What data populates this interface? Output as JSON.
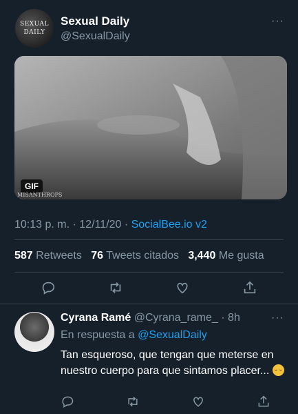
{
  "tweet": {
    "avatar_text": [
      "SEXUAL",
      "DAILY"
    ],
    "name": "Sexual Daily",
    "handle": "@SexualDaily",
    "more_label": "···",
    "media_badge": "GIF",
    "media_watermark": "MISANTHROPS",
    "time": "10:13 p. m.",
    "date": "12/11/20",
    "separator": "·",
    "source": "SocialBee.io v2",
    "retweets_count": "587",
    "retweets_label": "Retweets",
    "quotes_count": "76",
    "quotes_label": "Tweets citados",
    "likes_count": "3,440",
    "likes_label": "Me gusta"
  },
  "reply": {
    "name": "Cyrana Ramé",
    "handle": "@Cyrana_rame_",
    "age": "· 8h",
    "more_label": "···",
    "replying_prefix": "En respuesta a",
    "replying_to": "@SexualDaily",
    "text": "Tan esqueroso, que tengan que meterse en nuestro cuerpo para que sintamos placer..."
  },
  "icons": [
    "reply-icon",
    "retweet-icon",
    "like-icon",
    "share-icon"
  ],
  "colors": {
    "background": "#15202b",
    "link": "#1da1f2",
    "muted": "#8899a6",
    "divider": "#38444d"
  }
}
